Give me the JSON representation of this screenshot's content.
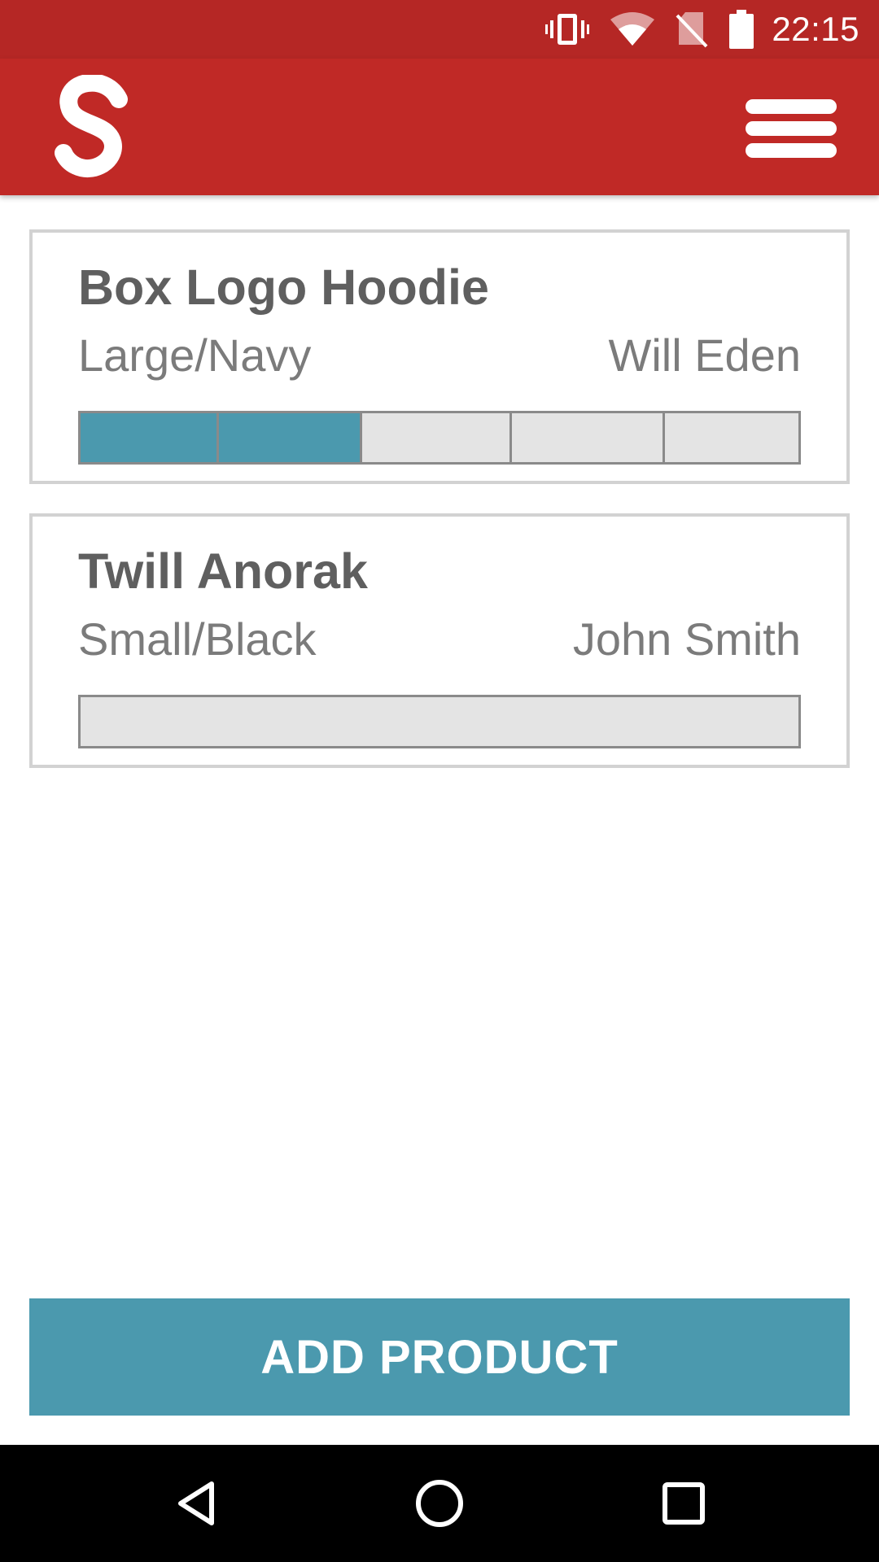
{
  "status_bar": {
    "time": "22:15",
    "icons": [
      "vibrate-icon",
      "wifi-icon",
      "no-sim-icon",
      "battery-icon"
    ]
  },
  "app_bar": {
    "logo_letter": "S",
    "menu_icon": "hamburger-menu-icon"
  },
  "products": [
    {
      "name": "Box Logo Hoodie",
      "variant": "Large/Navy",
      "owner": "Will Eden",
      "progress": {
        "filled_steps": 2,
        "total_steps": 5
      }
    },
    {
      "name": "Twill Anorak",
      "variant": "Small/Black",
      "owner": "John Smith",
      "progress": {
        "filled_steps": 0,
        "total_steps": 1
      }
    }
  ],
  "add_button": {
    "label": "ADD PRODUCT"
  },
  "nav_bar": {
    "icons": [
      "back-icon",
      "home-icon",
      "recents-icon"
    ]
  },
  "colors": {
    "status_bar": "#b52725",
    "app_bar": "#c02926",
    "accent": "#4b99ae",
    "track": "#e4e4e4",
    "card_border": "#d2d2d2",
    "title_text": "#5f5f5f",
    "secondary_text": "#7b7b7b"
  }
}
